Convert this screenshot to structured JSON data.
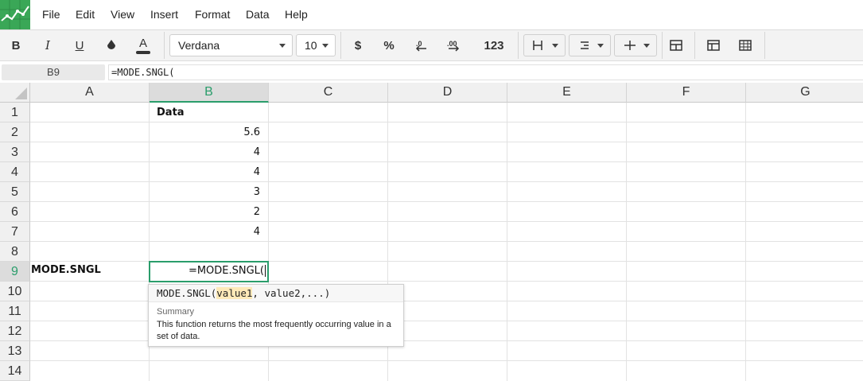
{
  "menu": [
    "File",
    "Edit",
    "View",
    "Insert",
    "Format",
    "Data",
    "Help"
  ],
  "toolbar": {
    "bold": "B",
    "italic": "I",
    "underline": "U",
    "font_family": "Verdana",
    "font_size": "10",
    "currency": "$",
    "percent": "%",
    "number_format": "123"
  },
  "formula_bar": {
    "cell_ref": "B9",
    "formula": "=MODE.SNGL("
  },
  "columns": [
    "A",
    "B",
    "C",
    "D",
    "E",
    "F",
    "G"
  ],
  "active_column": "B",
  "rows": [
    "1",
    "2",
    "3",
    "4",
    "5",
    "6",
    "7",
    "8",
    "9",
    "10",
    "11",
    "12",
    "13",
    "14"
  ],
  "active_row": "9",
  "cells": {
    "B1": "Data",
    "B2": "5.6",
    "B3": "4",
    "B4": "4",
    "B5": "3",
    "B6": "2",
    "B7": "4",
    "A9": "MODE.SNGL",
    "B9": "=MODE.SNGL("
  },
  "autocomplete": {
    "fn_name": "MODE.SNGL(",
    "arg_highlight": "value1",
    "arg_rest": ", value2,...)",
    "summary_title": "Summary",
    "summary_text": "This function returns the most frequently occurring value in a set of data."
  },
  "colors": {
    "accent": "#2a9d6b",
    "logo": "#3aa757"
  }
}
